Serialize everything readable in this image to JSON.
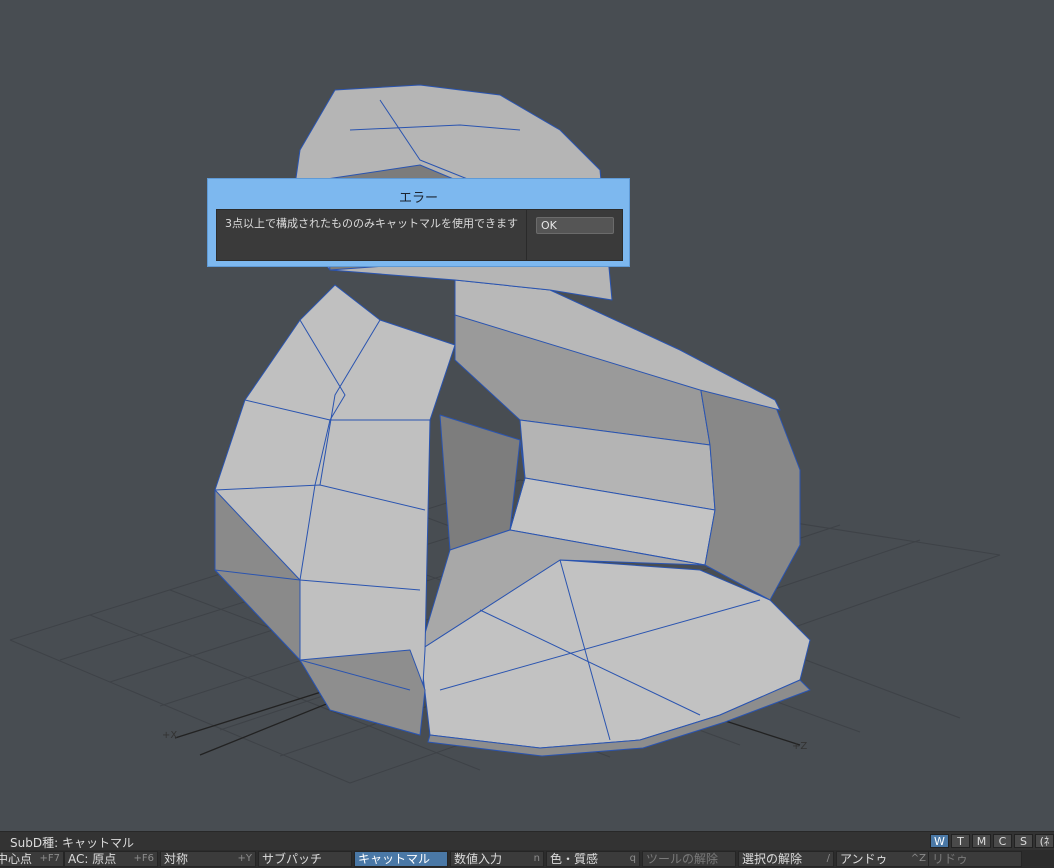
{
  "dialog": {
    "title": "エラー",
    "message": "3点以上で構成されたもののみキャットマルを使用できます",
    "ok_label": "OK"
  },
  "viewport": {
    "axis_x_label": "+X",
    "axis_z_label": "+Z"
  },
  "statusbar": {
    "text": "SubD種: キャットマル",
    "mode_buttons": [
      "W",
      "T",
      "M",
      "C",
      "S",
      "(ﾈ"
    ]
  },
  "commands": [
    {
      "label": "中心点",
      "key": "+F7"
    },
    {
      "label": "AC: 原点",
      "key": "+F6"
    },
    {
      "label": "対称",
      "key": "+Y"
    },
    {
      "label": "サブパッチ",
      "key": ""
    },
    {
      "label": "キャットマル",
      "key": ""
    },
    {
      "label": "数値入力",
      "key": "n"
    },
    {
      "label": "色・質感",
      "key": "q"
    },
    {
      "label": "ツールの解除",
      "key": ""
    },
    {
      "label": "選択の解除",
      "key": "/"
    },
    {
      "label": "アンドゥ",
      "key": "^Z"
    },
    {
      "label": "リドゥ",
      "key": ""
    }
  ],
  "colors": {
    "background": "#484d52",
    "wire": "#2a54b0",
    "dialog_frame": "#7db8ef",
    "active_button": "#4a78a6"
  }
}
